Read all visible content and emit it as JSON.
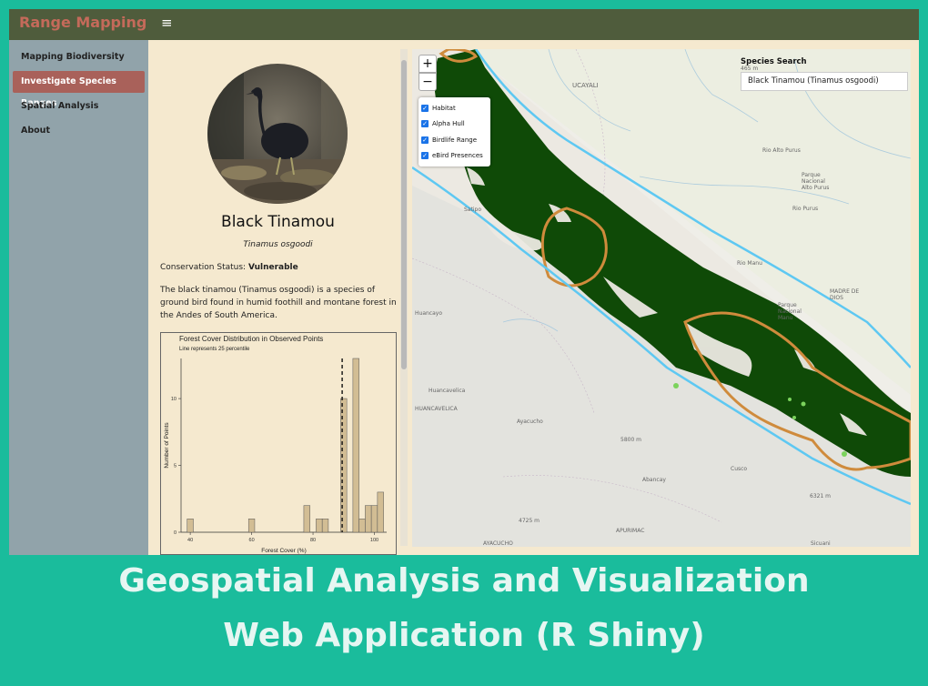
{
  "app": {
    "brand": "Range Mapping",
    "menu_icon": "hamburger-icon"
  },
  "nav": {
    "items": [
      {
        "label": "Mapping Biodiversity",
        "active": false
      },
      {
        "label": "Investigate Species Ranges",
        "active": true
      },
      {
        "label": "Spatial Analysis",
        "active": false
      },
      {
        "label": "About",
        "active": false
      }
    ]
  },
  "species": {
    "common_name": "Black Tinamou",
    "scientific_name": "Tinamus osgoodi",
    "status_label": "Conservation Status:",
    "status_value": "Vulnerable",
    "description": "The black tinamou (Tinamus osgoodi) is a species of ground bird found in humid foothill and montane forest in the Andes of South America."
  },
  "chart_data": {
    "type": "bar",
    "title": "Forest Cover Distribution in Observed Points",
    "subtitle": "Line represents 25 percentile",
    "xlabel": "Forest Cover (%)",
    "ylabel": "Number of Points",
    "x_ticks": [
      "40",
      "60",
      "80",
      "100"
    ],
    "y_ticks": [
      "0",
      "5",
      "10"
    ],
    "xlim": [
      37,
      104
    ],
    "ylim": [
      0,
      13
    ],
    "bin_width": 2,
    "bins": [
      {
        "x": 40,
        "count": 1
      },
      {
        "x": 60,
        "count": 1
      },
      {
        "x": 78,
        "count": 2
      },
      {
        "x": 82,
        "count": 1
      },
      {
        "x": 84,
        "count": 1
      },
      {
        "x": 90,
        "count": 10
      },
      {
        "x": 94,
        "count": 13
      },
      {
        "x": 96,
        "count": 1
      },
      {
        "x": 98,
        "count": 2
      },
      {
        "x": 100,
        "count": 2
      },
      {
        "x": 102,
        "count": 3
      }
    ],
    "vline": 89.5,
    "bar_color": "#d2bd94"
  },
  "map": {
    "zoom_in": "+",
    "zoom_out": "−",
    "layers": [
      "Habitat",
      "Alpha Hull",
      "Birdlife Range",
      "eBird Presences"
    ],
    "search_label": "Species Search",
    "search_value": "Black Tinamou (Tinamus osgoodi)",
    "labels": [
      "UCAYALI",
      "Satipo",
      "Huancayo",
      "Huancavelica",
      "HUANCAVELICA",
      "Ayacucho",
      "Abancay",
      "Cusco",
      "APURIMAC",
      "AYACUCHO",
      "MADRE DE DIOS",
      "Parque Nacional Manu",
      "Parque Nacional Alto Purus",
      "Rio Manu",
      "Rio Alto Purus",
      "Rio Purus",
      "Sicuani",
      "5800 m",
      "6321 m",
      "4725 m",
      "465 m"
    ],
    "colors": {
      "habitat": "#0f4a07",
      "hull": "#cf8b3c",
      "birdlife": "#5ec8f2",
      "ebird": "#7bd35c",
      "park": "#d7e6c2"
    }
  },
  "caption": {
    "line1": "Geospatial Analysis and Visualization",
    "line2": "Web Application (R Shiny)"
  }
}
